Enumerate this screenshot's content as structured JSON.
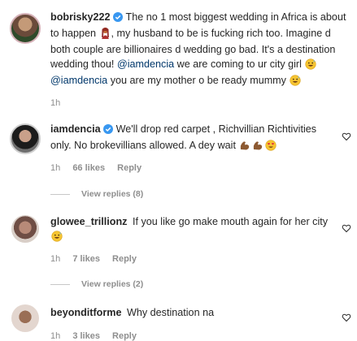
{
  "comments": [
    {
      "username": "bobrisky222",
      "verified": true,
      "text_parts": {
        "p1": "The no 1 most biggest wedding in Africa is about to happen",
        "p2": ", my husband to be is fucking rich too. Imagine d both couple are billionaires d wedding go bad. It's a destination wedding thou!",
        "mention1": "@iamdencia",
        "p3": "we are coming to ur city girl",
        "mention2": "@iamdencia",
        "p4": "you are my mother o be ready mummy"
      },
      "time": "1h"
    },
    {
      "username": "iamdencia",
      "verified": true,
      "text": "We'll drop red carpet , Richvillian Richtivities only. No brokevillians allowed. A dey wait",
      "time": "1h",
      "likes": "66 likes",
      "reply_label": "Reply",
      "view_replies": "View replies (8)"
    },
    {
      "username": "glowee_trillionz",
      "verified": false,
      "text": "If you like go make mouth again for her city",
      "time": "1h",
      "likes": "7 likes",
      "reply_label": "Reply",
      "view_replies": "View replies (2)"
    },
    {
      "username": "beyonditforme",
      "verified": false,
      "text": "Why destination na",
      "time": "1h",
      "likes": "3 likes",
      "reply_label": "Reply"
    }
  ],
  "icons": {
    "like": "heart-outline-icon",
    "verified": "verified-badge-icon"
  },
  "colors": {
    "verified": "#3897f0",
    "mention": "#00376b",
    "meta": "#8e8e8e"
  }
}
